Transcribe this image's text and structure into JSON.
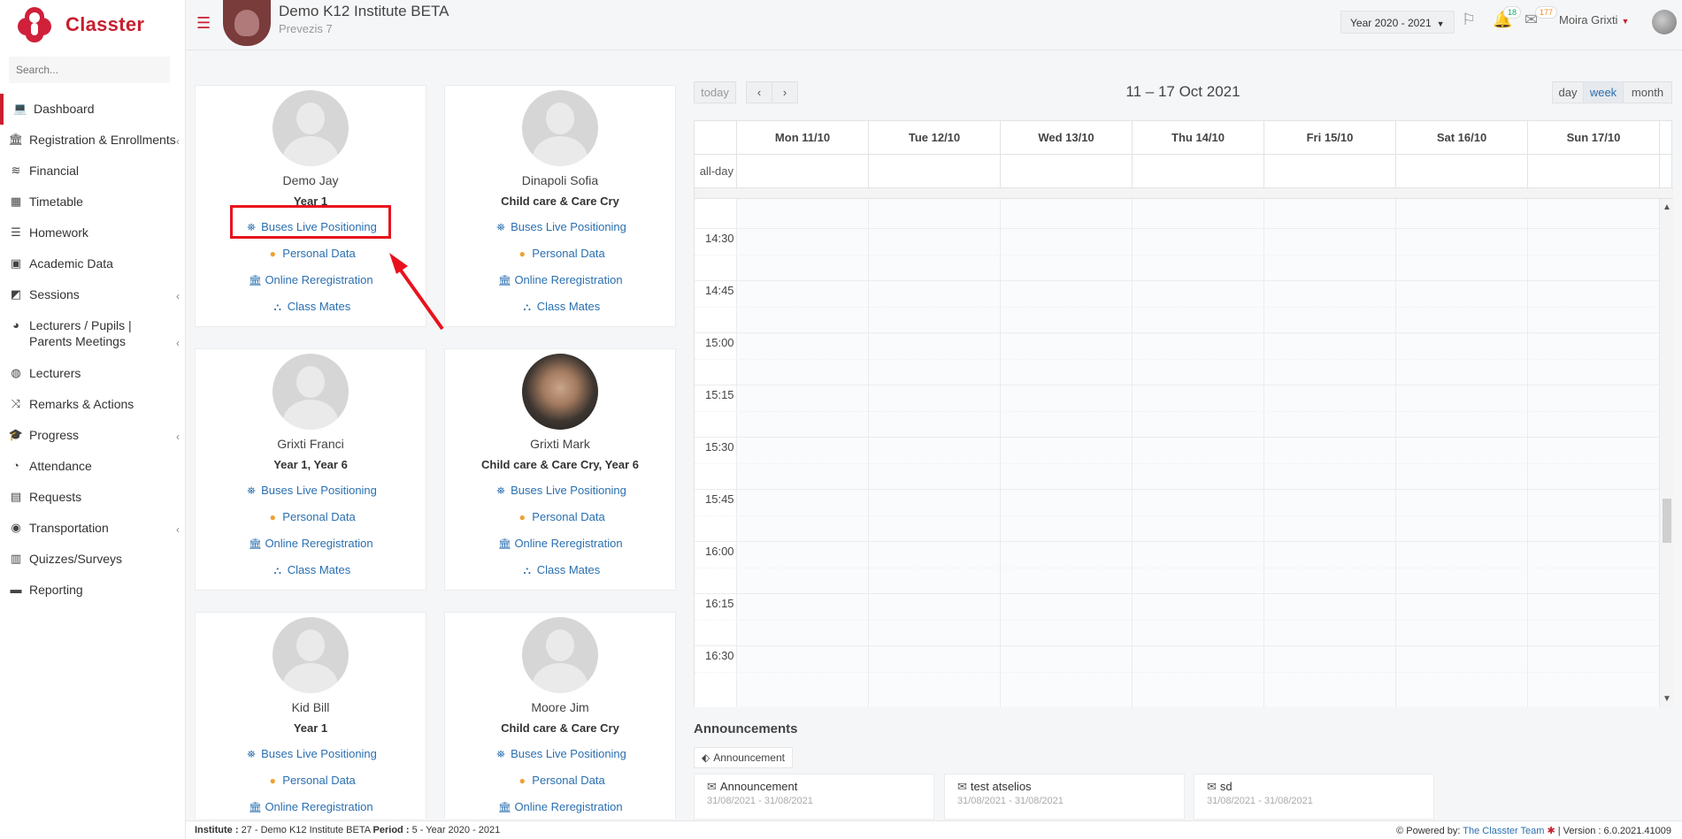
{
  "brand": {
    "name": "Classter"
  },
  "search": {
    "placeholder": "Search..."
  },
  "sidebar": {
    "items": [
      {
        "label": "Dashboard",
        "icon": "laptop-icon",
        "active": true,
        "chevron": false
      },
      {
        "label": "Registration & Enrollments",
        "icon": "institution-icon",
        "chevron": true
      },
      {
        "label": "Financial",
        "icon": "coins-icon",
        "chevron": false
      },
      {
        "label": "Timetable",
        "icon": "calendar-icon",
        "chevron": false
      },
      {
        "label": "Homework",
        "icon": "list-icon",
        "chevron": false
      },
      {
        "label": "Academic Data",
        "icon": "user-card-icon",
        "chevron": false
      },
      {
        "label": "Sessions",
        "icon": "presentation-icon",
        "chevron": true
      },
      {
        "label": "Lecturers / Pupils | Parents Meetings",
        "icon": "user-clock-icon",
        "chevron": true
      },
      {
        "label": "Lecturers",
        "icon": "users-icon",
        "chevron": false
      },
      {
        "label": "Remarks & Actions",
        "icon": "random-icon",
        "chevron": false
      },
      {
        "label": "Progress",
        "icon": "graduation-cap-icon",
        "chevron": true
      },
      {
        "label": "Attendance",
        "icon": "user-check-icon",
        "chevron": false
      },
      {
        "label": "Requests",
        "icon": "file-icon",
        "chevron": false
      },
      {
        "label": "Transportation",
        "icon": "bus-icon",
        "chevron": true
      },
      {
        "label": "Quizzes/Surveys",
        "icon": "book-icon",
        "chevron": false
      },
      {
        "label": "Reporting",
        "icon": "print-icon",
        "chevron": false
      }
    ]
  },
  "header": {
    "school_name": "Demo K12 Institute BETA",
    "school_sub": "Prevezis 7",
    "year_select": "Year 2020 - 2021",
    "notifications_count": "18",
    "messages_count": "177",
    "user_name": "Moira Grixti"
  },
  "students": [
    {
      "name": "Demo Jay",
      "grade": "Year 1",
      "photo": "placeholder"
    },
    {
      "name": "Dinapoli Sofia",
      "grade": "Child care & Care Cry",
      "photo": "placeholder"
    },
    {
      "name": "Grixti Franci",
      "grade": "Year 1, Year 6",
      "photo": "placeholder"
    },
    {
      "name": "Grixti Mark",
      "grade": "Child care & Care Cry, Year 6",
      "photo": "real"
    },
    {
      "name": "Kid Bill",
      "grade": "Year 1",
      "photo": "placeholder"
    },
    {
      "name": "Moore Jim",
      "grade": "Child care & Care Cry",
      "photo": "placeholder"
    }
  ],
  "student_links": {
    "buses": "Buses Live Positioning",
    "personal": "Personal Data",
    "rereg": "Online Reregistration",
    "classmates": "Class Mates"
  },
  "calendar": {
    "today_label": "today",
    "prev_label": "‹",
    "next_label": "›",
    "title": "11 – 17 Oct 2021",
    "views": {
      "day": "day",
      "week": "week",
      "month": "month",
      "active": "week"
    },
    "days": [
      "Mon 11/10",
      "Tue 12/10",
      "Wed 13/10",
      "Thu 14/10",
      "Fri 15/10",
      "Sat 16/10",
      "Sun 17/10"
    ],
    "allday_label": "all-day",
    "time_slots": [
      "14:30",
      "14:45",
      "15:00",
      "15:15",
      "15:30",
      "15:45",
      "16:00",
      "16:15",
      "16:30"
    ]
  },
  "announcements": {
    "title": "Announcements",
    "tag": "Announcement",
    "items": [
      {
        "title": "Announcement",
        "date": "31/08/2021 - 31/08/2021"
      },
      {
        "title": "test atselios",
        "date": "31/08/2021 - 31/08/2021"
      },
      {
        "title": "sd",
        "date": "31/08/2021 - 31/08/2021"
      }
    ]
  },
  "footer": {
    "institute_label": "Institute :",
    "institute_value": "27 - Demo K12 Institute BETA",
    "period_label": "Period :",
    "period_value": "5 - Year 2020 - 2021",
    "powered_label": "Powered by:",
    "powered_link": "The Classter Team",
    "version": "| Version : 6.0.2021.41009"
  },
  "colors": {
    "brand": "#c8202f",
    "link": "#2a6fb0",
    "highlight": "#e8121d"
  }
}
